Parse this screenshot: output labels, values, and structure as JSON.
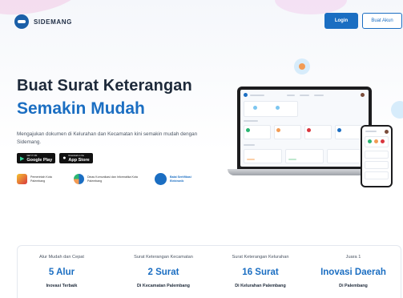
{
  "header": {
    "brand": "SIDEMANG",
    "login_label": "Login",
    "register_label": "Buat Akun"
  },
  "hero": {
    "title_line1": "Buat Surat Keterangan",
    "title_line2": "Semakin Mudah",
    "description": "Mengajukan dokumen di Kelurahan dan Kecamatan kini semakin mudah dengan Sidemang."
  },
  "stores": {
    "google_small": "GET IT ON",
    "google_label": "Google Play",
    "apple_small": "Download on the",
    "apple_label": "App Store"
  },
  "partners": [
    {
      "label": "Pemerintah Kota Palembang"
    },
    {
      "label": "Dinas Komunikasi dan Informatika Kota Palembang"
    },
    {
      "label": "Balai Sertifikasi Elektronik"
    }
  ],
  "stats": [
    {
      "caption": "Alur Mudah dan Cepat",
      "value": "5 Alur",
      "sub": "Inovasi Terbaik"
    },
    {
      "caption": "Surat Keterangan Kecamatan",
      "value": "2 Surat",
      "sub": "Di Kecamatan Palembang"
    },
    {
      "caption": "Surat Keterangan Kelurahan",
      "value": "16 Surat",
      "sub": "Di Kelurahan Palembang"
    },
    {
      "caption": "Juara 1",
      "value": "Inovasi Daerah",
      "sub": "Di Palembang"
    }
  ],
  "colors": {
    "primary": "#1b6ec2",
    "title": "#1e2a3a",
    "accent_orange": "#f29b54"
  }
}
